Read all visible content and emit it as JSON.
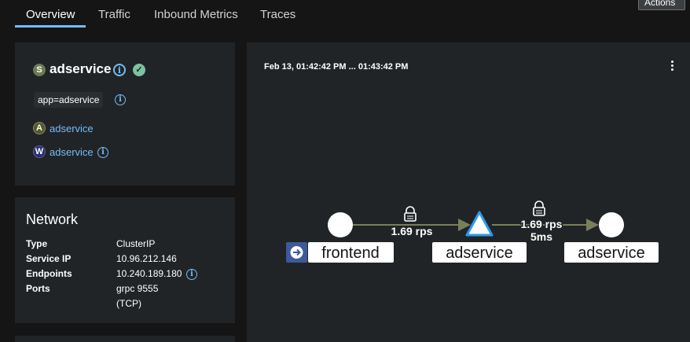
{
  "tabs": [
    {
      "label": "Overview",
      "active": true
    },
    {
      "label": "Traffic",
      "active": false
    },
    {
      "label": "Inbound Metrics",
      "active": false
    },
    {
      "label": "Traces",
      "active": false
    }
  ],
  "actions_label": "Actions",
  "service": {
    "badge": "S",
    "name": "adservice",
    "label_chip": "app=adservice",
    "app_badge": "A",
    "app_link": "adservice",
    "workload_badge": "W",
    "workload_link": "adservice",
    "info_glyph": "i",
    "check_glyph": "✓"
  },
  "network": {
    "title": "Network",
    "type_label": "Type",
    "type_value": "ClusterIP",
    "ip_label": "Service IP",
    "ip_value": "10.96.212.146",
    "endpoints_label": "Endpoints",
    "endpoints_value": "10.240.189.180",
    "ports_label": "Ports",
    "ports_value_1": "grpc 9555",
    "ports_value_2": "(TCP)"
  },
  "graph": {
    "time_range": "Feb 13, 01:42:42 PM ... 01:43:42 PM",
    "nodes": [
      {
        "label": "frontend",
        "shape": "circle"
      },
      {
        "label": "adservice",
        "shape": "triangle"
      },
      {
        "label": "adservice",
        "shape": "circle"
      }
    ],
    "edges": [
      {
        "rate": "1.69 rps",
        "latency": ""
      },
      {
        "rate": "1.69 rps",
        "latency": "5ms"
      }
    ],
    "colors": {
      "accent": "#73bcf7",
      "edge": "#7a7e5a",
      "node_fill": "#ffffff"
    }
  },
  "icons": {
    "info": "info-circle-icon",
    "check": "check-circle-icon",
    "lock": "lock-icon",
    "arrow": "arrow-circle-right-icon",
    "kebab": "kebab-menu-icon"
  }
}
